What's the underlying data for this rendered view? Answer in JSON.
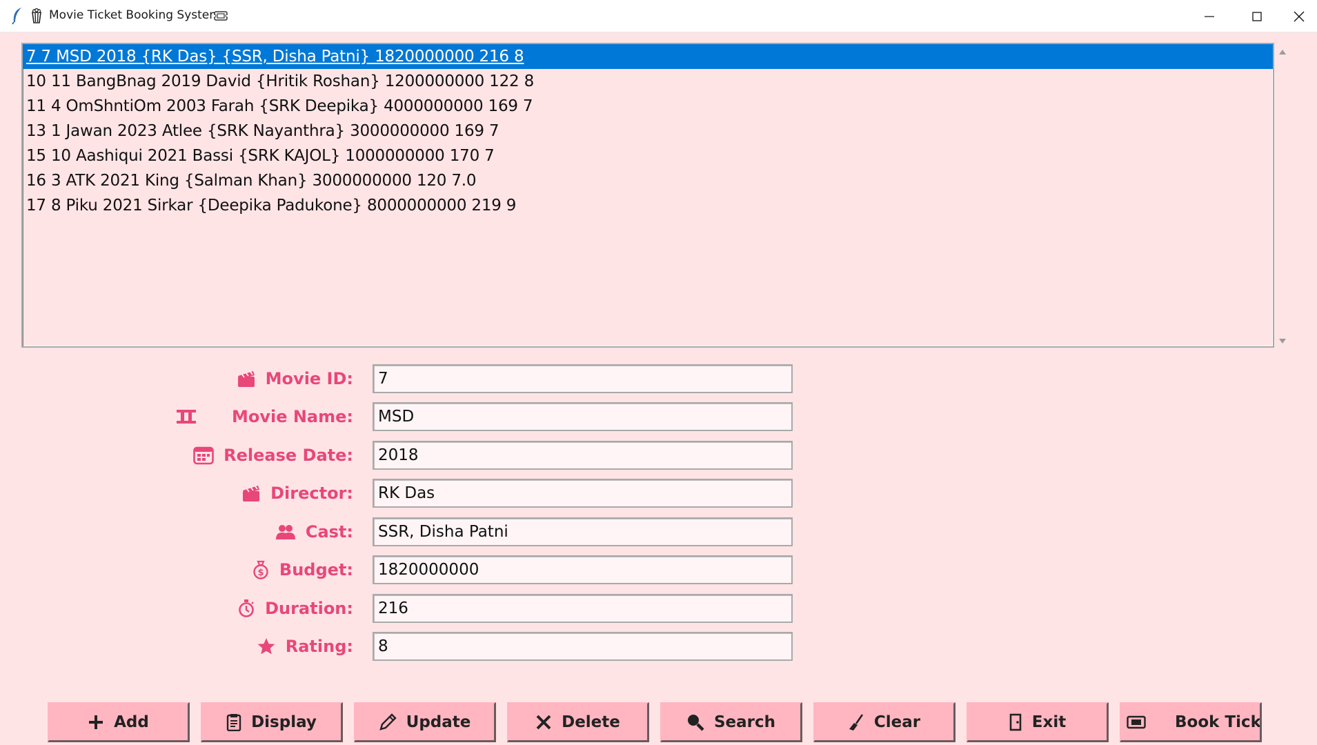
{
  "window": {
    "title": "Movie Ticket Booking System",
    "icons": [
      "feather-icon",
      "popcorn-icon",
      "ticket-icon"
    ]
  },
  "colors": {
    "background": "#ffe4e6",
    "label": "#e8477a",
    "button": "#ffb6c1",
    "selection": "#0078d7"
  },
  "listbox": {
    "selected_index": 0,
    "rows": [
      "7 7 MSD 2018 {RK Das} {SSR, Disha Patni} 1820000000 216 8",
      "10 11 BangBnag 2019 David {Hritik Roshan} 1200000000 122 8",
      "11 4 OmShntiOm 2003 Farah {SRK Deepika} 4000000000 169 7",
      "13 1 Jawan 2023 Atlee {SRK Nayanthra} 3000000000 169 7",
      "15 10 Aashiqui 2021 Bassi {SRK KAJOL} 1000000000 170 7",
      "16 3 ATK 2021 King {Salman Khan} 3000000000 120 7.0",
      "17 8 Piku 2021 Sirkar {Deepika Padukone} 8000000000 219 9"
    ]
  },
  "form": {
    "movie_id": {
      "label": "Movie ID:",
      "value": "7",
      "icon": "clapperboard-icon"
    },
    "movie_name": {
      "label": "Movie Name:",
      "value": "MSD",
      "icon": "film-icon"
    },
    "release_date": {
      "label": "Release Date:",
      "value": "2018",
      "icon": "calendar-icon"
    },
    "director": {
      "label": "Director:",
      "value": "RK Das",
      "icon": "clapperboard-icon"
    },
    "cast": {
      "label": "Cast:",
      "value": "SSR, Disha Patni",
      "icon": "people-icon"
    },
    "budget": {
      "label": "Budget:",
      "value": "1820000000",
      "icon": "money-bag-icon"
    },
    "duration": {
      "label": "Duration:",
      "value": "216",
      "icon": "stopwatch-icon"
    },
    "rating": {
      "label": "Rating:",
      "value": "8",
      "icon": "star-icon"
    }
  },
  "buttons": {
    "add": {
      "label": "Add",
      "icon": "plus-icon"
    },
    "display": {
      "label": "Display",
      "icon": "clipboard-icon"
    },
    "update": {
      "label": "Update",
      "icon": "pencil-icon"
    },
    "delete": {
      "label": "Delete",
      "icon": "x-icon"
    },
    "search": {
      "label": "Search",
      "icon": "magnifier-icon"
    },
    "clear": {
      "label": "Clear",
      "icon": "broom-icon"
    },
    "exit": {
      "label": "Exit",
      "icon": "door-icon"
    },
    "book_ticket": {
      "label": "Book Ticket",
      "icon": "ticket-icon"
    }
  }
}
